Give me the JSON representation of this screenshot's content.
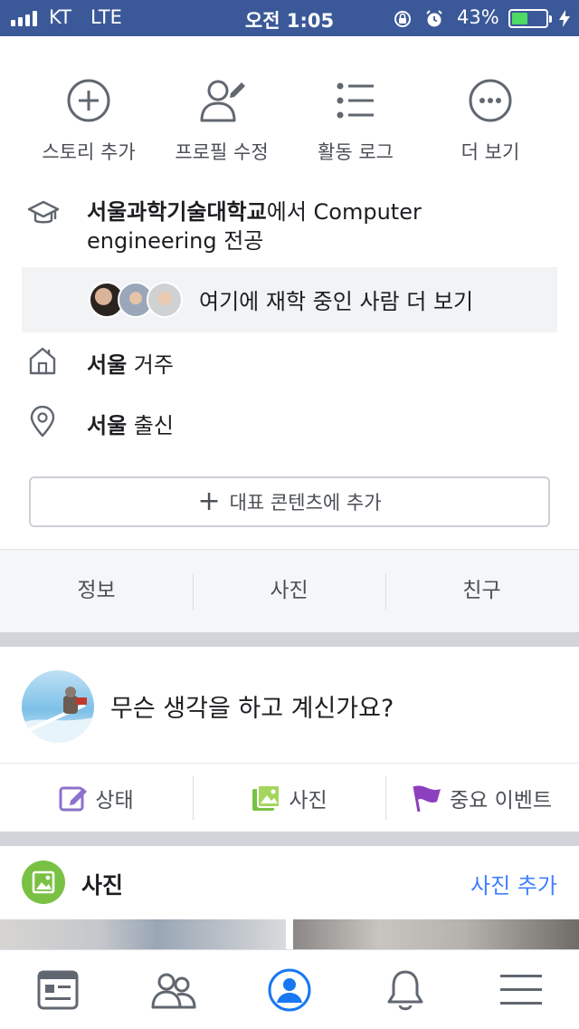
{
  "status_bar": {
    "carrier": "KT",
    "network": "LTE",
    "time": "오전 1:05",
    "battery_percent_text": "43%",
    "battery_level": 0.43
  },
  "profile_actions": [
    {
      "label": "스토리 추가",
      "icon": "add-circle-icon"
    },
    {
      "label": "프로필 수정",
      "icon": "edit-profile-icon"
    },
    {
      "label": "활동 로그",
      "icon": "activity-list-icon"
    },
    {
      "label": "더 보기",
      "icon": "more-icon"
    }
  ],
  "about": {
    "education": {
      "school": "서울과학기술대학교",
      "rest": "에서 Computer engineering 전공",
      "icon": "graduation-cap-icon"
    },
    "classmates_label": "여기에 재학 중인 사람 더 보기",
    "lives_in": {
      "city": "서울",
      "suffix": " 거주",
      "icon": "home-icon"
    },
    "from": {
      "city": "서울",
      "suffix": " 출신",
      "icon": "location-pin-icon"
    }
  },
  "featured_button": "대표 콘텐츠에 추가",
  "sub_tabs": [
    "정보",
    "사진",
    "친구"
  ],
  "composer": {
    "prompt": "무슨 생각을 하고 계신가요?",
    "actions": [
      {
        "label": "상태",
        "icon": "status-edit-icon",
        "color": "#8c72cb"
      },
      {
        "label": "사진",
        "icon": "photo-icon",
        "color": "#7ac143"
      },
      {
        "label": "중요 이벤트",
        "icon": "flag-icon",
        "color": "#8c3fbf"
      }
    ]
  },
  "photos": {
    "title": "사진",
    "add_label": "사진 추가"
  },
  "tab_bar": [
    {
      "icon": "news-feed-icon",
      "active": false
    },
    {
      "icon": "friends-icon",
      "active": false
    },
    {
      "icon": "profile-icon",
      "active": true
    },
    {
      "icon": "notifications-icon",
      "active": false
    },
    {
      "icon": "menu-icon",
      "active": false
    }
  ],
  "colors": {
    "brand_blue": "#3b5998",
    "link_blue": "#4080ff",
    "active_tab": "#1877f2"
  }
}
